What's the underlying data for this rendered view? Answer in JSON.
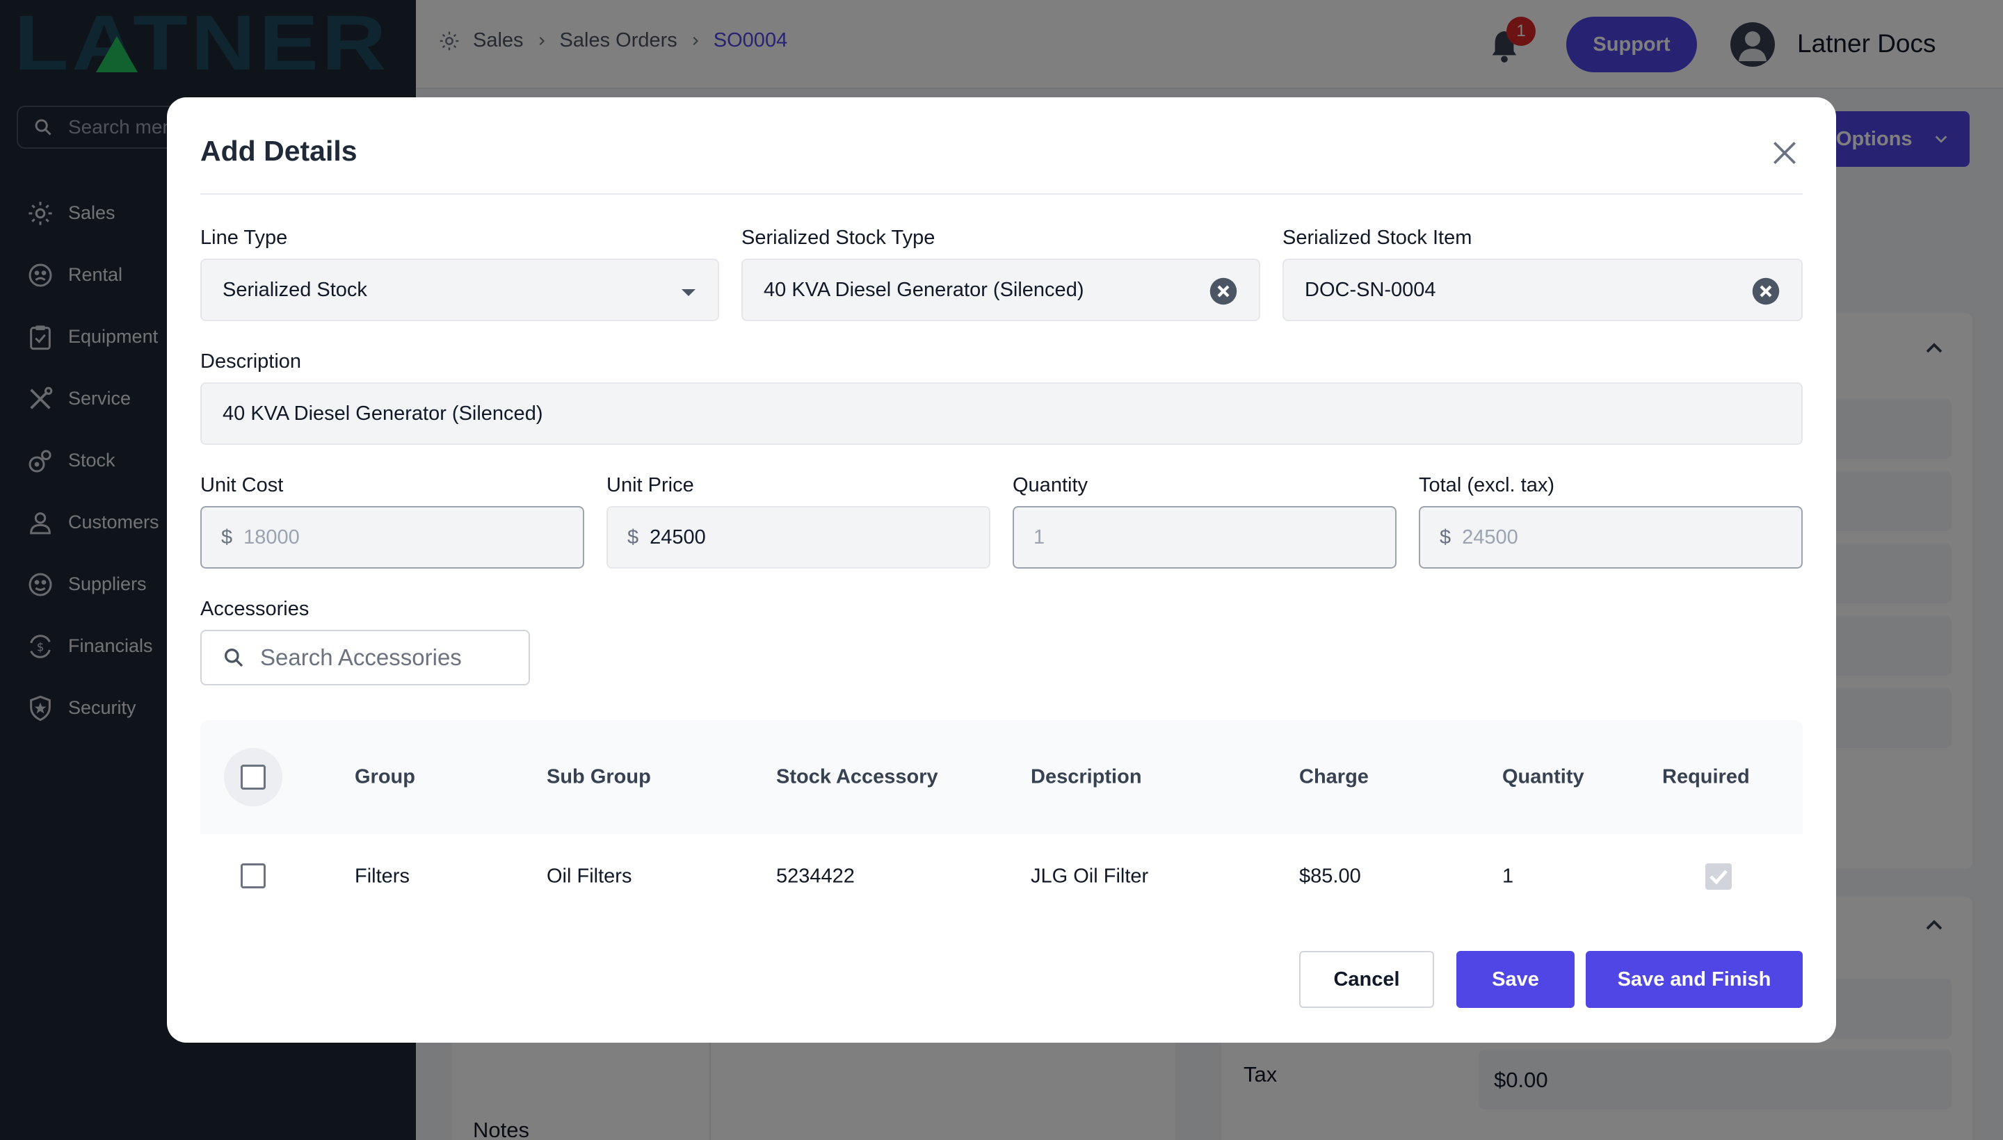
{
  "brand": {
    "logo_text": "LATNER",
    "logo_color": "#1f4a5e",
    "accent_triangle": "#22c55e"
  },
  "sidebar": {
    "search_placeholder": "Search menu",
    "items": [
      {
        "label": "Sales",
        "icon": "sales-icon"
      },
      {
        "label": "Rental",
        "icon": "rental-icon"
      },
      {
        "label": "Equipment",
        "icon": "clipboard-icon"
      },
      {
        "label": "Service",
        "icon": "tools-icon"
      },
      {
        "label": "Stock",
        "icon": "stock-icon"
      },
      {
        "label": "Customers",
        "icon": "user-icon"
      },
      {
        "label": "Suppliers",
        "icon": "suppliers-icon"
      },
      {
        "label": "Financials",
        "icon": "financials-icon"
      },
      {
        "label": "Security",
        "icon": "shield-icon"
      }
    ]
  },
  "topbar": {
    "breadcrumb": [
      "Sales",
      "Sales Orders",
      "SO0004"
    ],
    "notification_count": "1",
    "support_label": "Support",
    "user_name": "Latner Docs"
  },
  "page": {
    "options_label": "Options",
    "notes_label": "Notes",
    "tax_label": "Tax",
    "tax_value": "$0.00"
  },
  "modal": {
    "title": "Add Details",
    "line_type": {
      "label": "Line Type",
      "value": "Serialized Stock"
    },
    "stock_type": {
      "label": "Serialized Stock Type",
      "value": "40 KVA Diesel Generator (Silenced)"
    },
    "stock_item": {
      "label": "Serialized Stock Item",
      "value": "DOC-SN-0004"
    },
    "description": {
      "label": "Description",
      "value": "40 KVA Diesel Generator (Silenced)"
    },
    "unit_cost": {
      "label": "Unit Cost",
      "currency": "$",
      "value": "18000"
    },
    "unit_price": {
      "label": "Unit Price",
      "currency": "$",
      "value": "24500"
    },
    "quantity": {
      "label": "Quantity",
      "value": "1"
    },
    "total": {
      "label": "Total (excl. tax)",
      "currency": "$",
      "value": "24500"
    },
    "accessories": {
      "label": "Accessories",
      "search_placeholder": "Search Accessories",
      "columns": [
        "Group",
        "Sub Group",
        "Stock Accessory",
        "Description",
        "Charge",
        "Quantity",
        "Required"
      ],
      "rows": [
        {
          "group": "Filters",
          "sub_group": "Oil Filters",
          "stock_accessory": "5234422",
          "description": "JLG Oil Filter",
          "charge": "$85.00",
          "quantity": "1",
          "required": true
        }
      ]
    },
    "buttons": {
      "cancel": "Cancel",
      "save": "Save",
      "save_finish": "Save and Finish"
    }
  },
  "colors": {
    "primary": "#4f46e5",
    "sidebar_bg": "#1f2937",
    "badge": "#dc2626"
  }
}
